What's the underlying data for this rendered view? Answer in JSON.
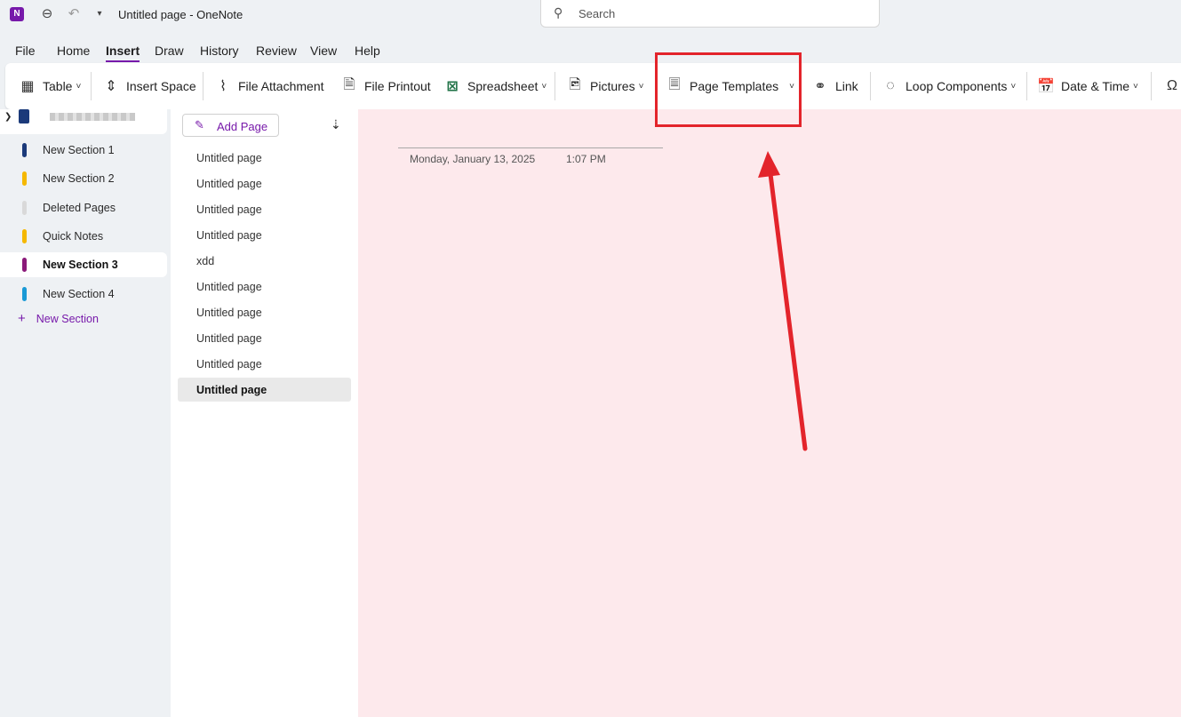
{
  "titlebar": {
    "app_icon": "N",
    "title": "Untitled page  -  OneNote",
    "back_icon": "back-icon",
    "undo_icon": "undo-icon",
    "qat_icon": "customize-quick-access-icon"
  },
  "search": {
    "placeholder": "Search",
    "icon": "search-icon"
  },
  "menu": {
    "tabs": [
      {
        "label": "File"
      },
      {
        "label": "Home"
      },
      {
        "label": "Insert",
        "active": true
      },
      {
        "label": "Draw"
      },
      {
        "label": "History"
      },
      {
        "label": "Review"
      },
      {
        "label": "View"
      },
      {
        "label": "Help"
      }
    ]
  },
  "ribbon": {
    "table": "Table",
    "insert_space": "Insert Space",
    "file_attachment": "File Attachment",
    "file_printout": "File Printout",
    "spreadsheet": "Spreadsheet",
    "pictures": "Pictures",
    "page_templates": "Page Templates",
    "link": "Link",
    "loop_components": "Loop Components",
    "date_time": "Date & Time",
    "chevron": "˅",
    "symbol": "Ω"
  },
  "sections": {
    "items": [
      {
        "label": "New Section 1",
        "color": "#1b3a7a"
      },
      {
        "label": "New Section 2",
        "color": "#f5b800"
      },
      {
        "label": "Deleted Pages",
        "color": "#d9d9d9"
      },
      {
        "label": "Quick Notes",
        "color": "#f5b800"
      },
      {
        "label": "New Section 3",
        "color": "#8b1a7a",
        "active": true
      },
      {
        "label": "New Section 4",
        "color": "#1a9ad6"
      }
    ],
    "new_section": "New Section"
  },
  "pages": {
    "add_page": "Add Page",
    "items": [
      {
        "label": "Untitled page"
      },
      {
        "label": "Untitled page"
      },
      {
        "label": "Untitled page"
      },
      {
        "label": "Untitled page"
      },
      {
        "label": "xdd"
      },
      {
        "label": "Untitled page"
      },
      {
        "label": "Untitled page"
      },
      {
        "label": "Untitled page"
      },
      {
        "label": "Untitled page"
      },
      {
        "label": "Untitled page",
        "active": true
      }
    ]
  },
  "canvas": {
    "date": "Monday, January 13, 2025",
    "time": "1:07 PM",
    "background": "#fde9ec"
  },
  "annotation": {
    "color": "#e3242b"
  }
}
